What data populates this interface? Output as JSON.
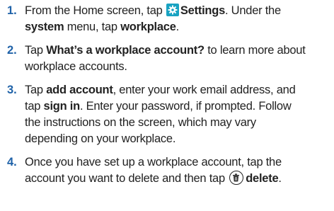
{
  "steps": [
    {
      "num": "1.",
      "lines": [
        {
          "t1": "From the Home screen, tap ",
          "icon": "gear-icon",
          "b1": "Settings",
          "t2": ". Under the"
        },
        {
          "b1": "system",
          "t1": " menu, tap ",
          "b2": "workplace",
          "t2": "."
        }
      ]
    },
    {
      "num": "2.",
      "lines": [
        {
          "t1": "Tap ",
          "b1": "What’s a workplace account?",
          "t2": " to learn more about"
        },
        {
          "t1": "workplace accounts."
        }
      ]
    },
    {
      "num": "3.",
      "lines": [
        {
          "t1": "Tap ",
          "b1": "add account",
          "t2": ", enter your work email address, and"
        },
        {
          "t1": "tap ",
          "b1": "sign in",
          "t2": ". Enter your password, if prompted. Follow"
        },
        {
          "t1": "the instructions on the screen, which may vary"
        },
        {
          "t1": "depending on your workplace."
        }
      ]
    },
    {
      "num": "4.",
      "lines": [
        {
          "t1": "Once you have set up a workplace account, tap the"
        },
        {
          "t1": "account you want to delete and then tap ",
          "icon": "trash-icon",
          "b1": "delete",
          "t2": "."
        }
      ]
    }
  ],
  "colors": {
    "number": "#1f62a8",
    "settings_tile": "#19a3c2",
    "text": "#222222"
  }
}
